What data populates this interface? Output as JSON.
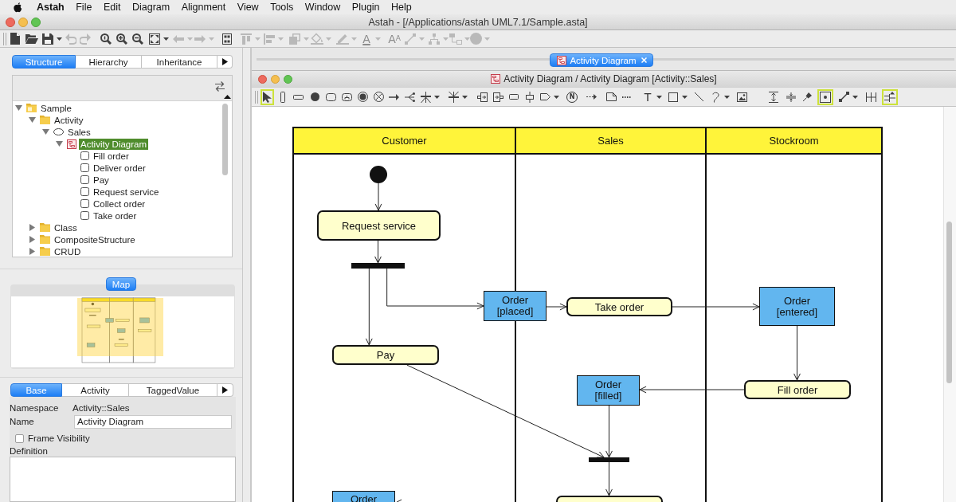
{
  "menu_bar": {
    "app": "Astah",
    "items": [
      "File",
      "Edit",
      "Diagram",
      "Alignment",
      "View",
      "Tools",
      "Window",
      "Plugin",
      "Help"
    ]
  },
  "window": {
    "title": "Astah - [/Applications/astah UML7.1/Sample.asta]"
  },
  "main_toolbar": [
    {
      "disabled": false
    },
    {
      "disabled": false
    },
    {
      "disabled": false
    },
    {
      "disabled": true
    },
    {
      "disabled": true
    },
    {
      "disabled": false
    },
    {
      "disabled": false
    },
    {
      "disabled": false
    },
    {
      "disabled": false
    },
    {
      "disabled": true
    },
    {
      "disabled": true
    },
    {
      "disabled": false
    },
    {
      "disabled": true
    },
    {
      "disabled": true
    },
    {
      "disabled": true
    },
    {
      "disabled": true
    },
    {
      "disabled": true
    },
    {
      "disabled": true,
      "glyph": "A"
    },
    {
      "disabled": true,
      "glyph": "A$^{A}$"
    },
    {
      "disabled": true
    },
    {
      "disabled": true
    },
    {
      "disabled": true
    },
    {
      "disabled": true
    }
  ],
  "explorer": {
    "tabs": [
      {
        "label": "Structure",
        "selected": true
      },
      {
        "label": "Hierarchy",
        "selected": false
      },
      {
        "label": "Inheritance",
        "selected": false
      }
    ],
    "tree": [
      {
        "kind": "project",
        "label": "Sample",
        "expanded": true,
        "selected": false,
        "children": [
          {
            "kind": "package",
            "label": "Activity",
            "expanded": true,
            "selected": false,
            "children": [
              {
                "kind": "element",
                "label": "Sales",
                "expanded": true,
                "selected": false,
                "children": [
                  {
                    "kind": "diagram",
                    "label": "Activity Diagram",
                    "expanded": true,
                    "selected": true,
                    "children": [
                      {
                        "kind": "action",
                        "label": "Fill order",
                        "selected": false
                      },
                      {
                        "kind": "action",
                        "label": "Deliver order",
                        "selected": false
                      },
                      {
                        "kind": "action",
                        "label": "Pay",
                        "selected": false
                      },
                      {
                        "kind": "action",
                        "label": "Request service",
                        "selected": false
                      },
                      {
                        "kind": "action",
                        "label": "Collect order",
                        "selected": false
                      },
                      {
                        "kind": "action",
                        "label": "Take order",
                        "selected": false
                      }
                    ]
                  }
                ]
              }
            ]
          },
          {
            "kind": "package",
            "label": "Class",
            "expanded": false,
            "selected": false
          },
          {
            "kind": "package",
            "label": "CompositeStructure",
            "expanded": false,
            "selected": false
          },
          {
            "kind": "package",
            "label": "CRUD",
            "expanded": false,
            "selected": false
          }
        ]
      }
    ]
  },
  "map": {
    "tabs": [
      {
        "label": "Map",
        "selected": true
      }
    ]
  },
  "properties": {
    "tabs": [
      {
        "label": "Base",
        "selected": true
      },
      {
        "label": "Activity",
        "selected": false
      },
      {
        "label": "TaggedValue",
        "selected": false
      }
    ],
    "namespace": {
      "label": "Namespace",
      "value": "Activity::Sales"
    },
    "name": {
      "label": "Name",
      "value": "Activity Diagram"
    },
    "frame_visibility": {
      "label": "Frame Visibility",
      "checked": false
    },
    "definition": {
      "label": "Definition"
    }
  },
  "editor": {
    "tabs": [
      {
        "label": "Activity Diagram",
        "selected": true
      }
    ],
    "title": "Activity Diagram / Activity Diagram [Activity::Sales]",
    "drawing_tools": [
      {
        "selected": true
      },
      {
        "selected": false
      },
      {
        "selected": false
      },
      {
        "selected": false
      },
      {
        "selected": false
      },
      {
        "selected": false
      },
      {
        "selected": false
      },
      {
        "selected": false
      },
      {
        "selected": false
      },
      {
        "selected": false
      },
      {
        "selected": false
      },
      {
        "selected": false
      },
      {
        "selected": false
      },
      {
        "selected": false
      },
      {
        "selected": false
      },
      {
        "selected": false
      },
      {
        "selected": false
      },
      {
        "selected": false,
        "glyph": "N"
      },
      {
        "selected": false
      },
      {
        "selected": false
      },
      {
        "selected": false
      },
      {
        "selected": false,
        "glyph": "T"
      },
      {
        "selected": false
      },
      {
        "selected": false
      },
      {
        "selected": false
      },
      {
        "selected": false
      }
    ],
    "view_toggles": [
      {
        "on": false
      },
      {
        "on": false
      },
      {
        "on": false
      },
      {
        "on": true
      },
      {
        "on": false
      },
      {
        "on": false
      },
      {
        "on": true
      }
    ],
    "diagram": {
      "partitions": [
        {
          "name": "Customer"
        },
        {
          "name": "Sales"
        },
        {
          "name": "Stockroom"
        }
      ],
      "nodes": [
        {
          "kind": "initial"
        },
        {
          "kind": "action",
          "label": "Request service"
        },
        {
          "kind": "fork"
        },
        {
          "kind": "object",
          "name": "Order",
          "state": "[placed]"
        },
        {
          "kind": "action",
          "label": "Take order"
        },
        {
          "kind": "object",
          "name": "Order",
          "state": "[entered]"
        },
        {
          "kind": "action",
          "label": "Pay"
        },
        {
          "kind": "action",
          "label": "Fill order"
        },
        {
          "kind": "object",
          "name": "Order",
          "state": "[filled]"
        },
        {
          "kind": "join"
        },
        {
          "kind": "object",
          "name": "Order"
        },
        {
          "kind": "action"
        }
      ]
    }
  }
}
